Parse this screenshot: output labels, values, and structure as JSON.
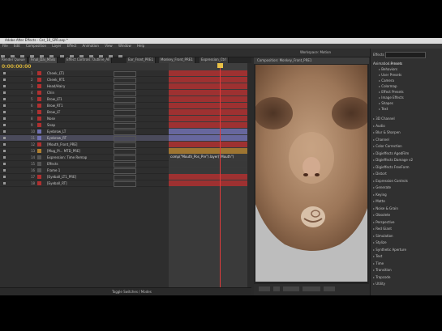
{
  "window": {
    "title": "Adobe After Effects - Cat_10_SPR.aep *"
  },
  "menu": [
    "File",
    "Edit",
    "Composition",
    "Layer",
    "Effect",
    "Animation",
    "View",
    "Window",
    "Help"
  ],
  "tabs": [
    "Render Queue",
    "Final_Dai_Mask",
    "Effect Controls: Outline_All",
    "Ear_Front_PRE1",
    "Monkey_Front_PRE1",
    "Expression_Ctrl"
  ],
  "timeline": {
    "timecode": "0:00:00:00",
    "footer_label": "Toggle Switches / Modes"
  },
  "layers": [
    {
      "num": "1",
      "name": "Cheek_LT1",
      "color": "#b03030"
    },
    {
      "num": "2",
      "name": "Cheek_RT1",
      "color": "#b03030"
    },
    {
      "num": "3",
      "name": "Head/Hairy",
      "color": "#b03030"
    },
    {
      "num": "4",
      "name": "Chin",
      "color": "#b03030"
    },
    {
      "num": "5",
      "name": "Brow_LT1",
      "color": "#b03030"
    },
    {
      "num": "6",
      "name": "Brow_RT1",
      "color": "#b03030"
    },
    {
      "num": "7",
      "name": "Brow_LT",
      "color": "#b03030"
    },
    {
      "num": "8",
      "name": "Nose",
      "color": "#b03030"
    },
    {
      "num": "9",
      "name": "Snap",
      "color": "#b03030"
    },
    {
      "num": "10",
      "name": "Eyebrow_LT",
      "color": "#7070b0"
    },
    {
      "num": "11",
      "name": "Eyebrow_RT",
      "color": "#7070b0"
    },
    {
      "num": "12",
      "name": "[Mouth_Front_PRE]",
      "color": "#b03030"
    },
    {
      "num": "13",
      "name": "[Mug_Pl... MTD_PRE]",
      "color": "#b08030"
    },
    {
      "num": "14",
      "name": "Expression: Time Remap",
      "color": "#555555"
    },
    {
      "num": "15",
      "name": "Effects",
      "color": "#555555"
    },
    {
      "num": "16",
      "name": "Frame 1",
      "color": "#555555"
    },
    {
      "num": "17",
      "name": "[Eyeball_LT1_PRE]",
      "color": "#b03030"
    },
    {
      "num": "18",
      "name": "[Eyeball_RT]",
      "color": "#b03030"
    }
  ],
  "expression": "comp(\"Mouth_Pos_Pre\").layer(\"Mouth\")",
  "comp": {
    "tab": "Composition: Monkey_Front_PRE1",
    "workspace": "Workspace: Motion"
  },
  "effects_panel": {
    "title": "Effects & Presets",
    "search_placeholder": "Contains",
    "animation_presets": [
      "Animation Presets",
      "Behaviors",
      "User Presets",
      "Camera",
      "Colormap",
      "Effect Presets",
      "Image Effects",
      "Shapes",
      "Text"
    ],
    "categories": [
      "3D Channel",
      "Audio",
      "Blur & Sharpen",
      "Channel",
      "Color Correction",
      "Digieffects AgedFilm",
      "Digieffects Damage v2",
      "Digieffects FreeForm",
      "Distort",
      "Expression Controls",
      "Generate",
      "Keying",
      "Matte",
      "Noise & Grain",
      "Obsolete",
      "Perspective",
      "Red Giant",
      "Simulation",
      "Stylize",
      "Synthetic Aperture",
      "Text",
      "Time",
      "Transition",
      "Trapcode",
      "Utility"
    ]
  }
}
